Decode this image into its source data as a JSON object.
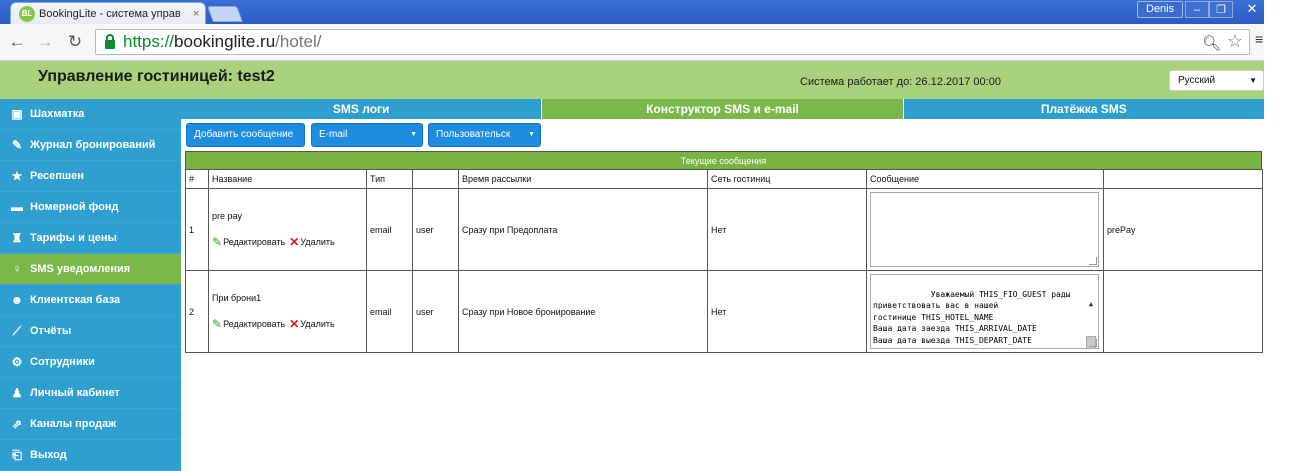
{
  "browser": {
    "tab_title": "BookingLite - система управ",
    "favicon_text": "BL",
    "profile_name": "Denis",
    "url_scheme": "https://",
    "url_host": "bookinglite.ru",
    "url_path": "/hotel/"
  },
  "header": {
    "hotel_title": "Управление гостиницей: test2",
    "system_until": "Система работает до: 26.12.2017 00:00",
    "language": "Русский"
  },
  "sidebar": {
    "items": [
      {
        "label": "Шахматка",
        "icon": "calendar-grid-icon"
      },
      {
        "label": "Журнал бронирований",
        "icon": "journal-icon"
      },
      {
        "label": "Ресепшен",
        "icon": "star-icon"
      },
      {
        "label": "Номерной фонд",
        "icon": "bed-icon"
      },
      {
        "label": "Тарифы и цены",
        "icon": "money-bag-icon"
      },
      {
        "label": "SMS уведомления",
        "icon": "notification-icon"
      },
      {
        "label": "Клиентская база",
        "icon": "client-face-icon"
      },
      {
        "label": "Отчёты",
        "icon": "line-chart-icon"
      },
      {
        "label": "Сотрудники",
        "icon": "gear-icon"
      },
      {
        "label": "Личный кабинет",
        "icon": "user-icon"
      },
      {
        "label": "Каналы продаж",
        "icon": "sales-channel-icon"
      },
      {
        "label": "Выход",
        "icon": "exit-icon"
      }
    ],
    "active_index": 5
  },
  "tabs": [
    {
      "label": "SMS логи"
    },
    {
      "label": "Конструктор SMS и e-mail"
    },
    {
      "label": "Платёжка SMS"
    }
  ],
  "actions": {
    "add_message": "Добавить сообщение",
    "type_select": "E-mail",
    "user_select": "Пользовательск"
  },
  "table": {
    "caption": "Текущие сообщения",
    "columns": [
      "#",
      "Название",
      "Тип",
      "",
      "Время рассылки",
      "Сеть гостиниц",
      "Сообщение",
      ""
    ],
    "edit_label": "Редактировать",
    "delete_label": "Удалить",
    "rows": [
      {
        "num": "1",
        "name": "pre pay",
        "type": "email",
        "recipient": "user",
        "send_time": "Сразу при Предоплата",
        "chain": "Нет",
        "message": "",
        "code": "prePay"
      },
      {
        "num": "2",
        "name": "При брони1",
        "type": "email",
        "recipient": "user",
        "send_time": "Сразу при Новое бронирование",
        "chain": "Нет",
        "message": "Уважаемый THIS_FIO_GUEST рады\nприветствовать вас в нашей\nгостинице THIS_HOTEL_NAME\nВаша дата заезда THIS_ARRIVAL_DATE\nВаша дата выезда THIS_DEPART_DATE\nВаш номер номер бронирования",
        "code": ""
      }
    ]
  },
  "colors": {
    "sidebar_blue": "#2f9fd0",
    "active_green": "#7ab84a",
    "header_green": "#a8d27b",
    "button_blue": "#1e8de0"
  }
}
